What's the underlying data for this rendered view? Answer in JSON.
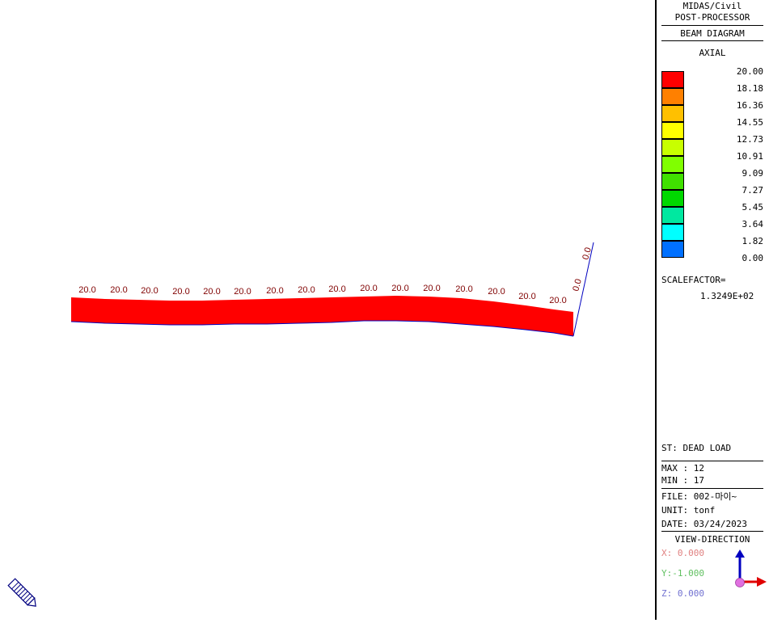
{
  "header": {
    "app_name": "MIDAS/Civil",
    "module": "POST-PROCESSOR",
    "diagram_type": "BEAM DIAGRAM",
    "component": "AXIAL"
  },
  "legend": {
    "values": [
      "20.00",
      "18.18",
      "16.36",
      "14.55",
      "12.73",
      "10.91",
      "9.09",
      "7.27",
      "5.45",
      "3.64",
      "1.82",
      "0.00"
    ],
    "colors": [
      "#ff0000",
      "#ff8000",
      "#ffc000",
      "#ffff00",
      "#c8ff00",
      "#80ff00",
      "#40e000",
      "#00d800",
      "#00e8a0",
      "#00ffff",
      "#0070ff"
    ]
  },
  "scalefactor": {
    "label": "SCALEFACTOR=",
    "value": "1.3249E+02"
  },
  "info": {
    "load_case": "ST: DEAD LOAD",
    "max": "MAX : 12",
    "min": "MIN : 17",
    "file": "FILE: 002-마이~",
    "unit": "UNIT: tonf",
    "date": "DATE: 03/24/2023"
  },
  "view_direction": {
    "title": "VIEW-DIRECTION",
    "x": "X: 0.000",
    "y": "Y:-1.000",
    "z": "Z: 0.000",
    "colors": {
      "x": "#e08080",
      "y": "#80e080",
      "z": "#8080e0"
    }
  },
  "beam": {
    "fill_color": "#ff0000",
    "outline_color": "#0000c0",
    "label_color": "#800000",
    "labels": [
      "20.0",
      "20.0",
      "20.0",
      "20.0",
      "20.0",
      "20.0",
      "20.0",
      "20.0",
      "20.0",
      "20.0",
      "20.0",
      "20.0",
      "20.0",
      "20.0",
      "20.0",
      "20.0"
    ],
    "pier_labels": [
      "0.0",
      "0.0"
    ]
  },
  "icons": {
    "view_tool": "pencil-icon",
    "axis_triad": "axis-triad-icon"
  }
}
